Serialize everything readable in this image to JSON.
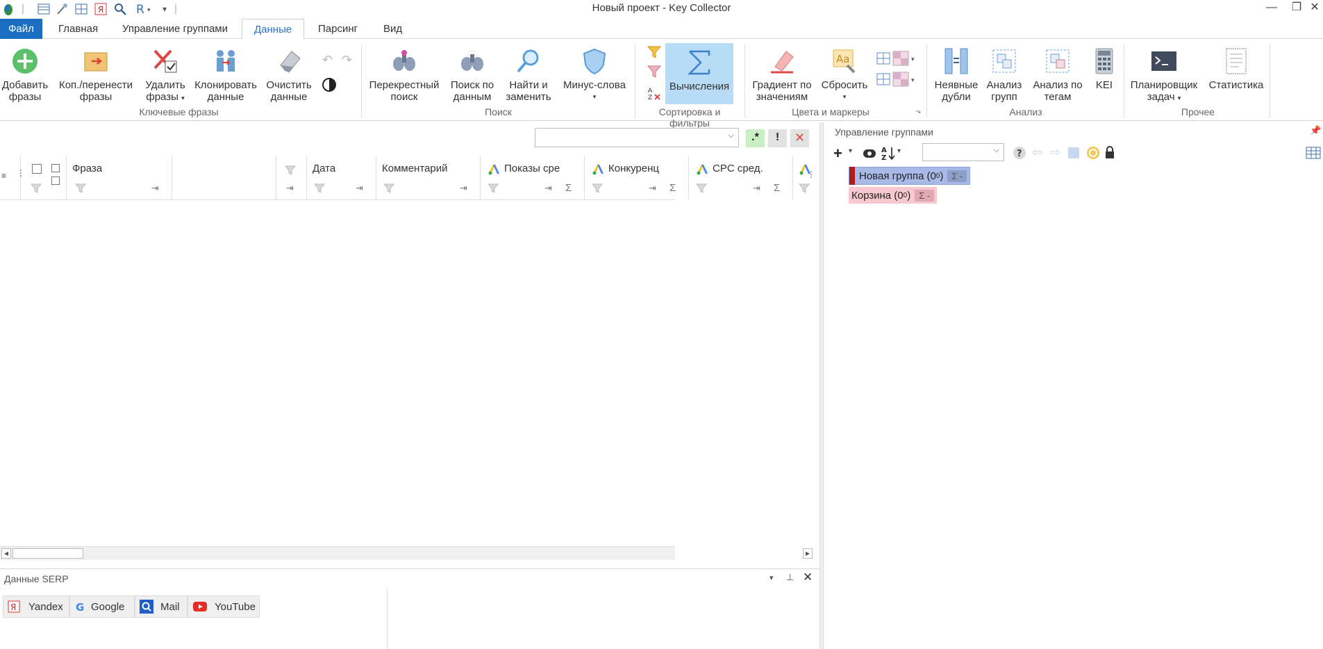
{
  "window": {
    "title": "Новый проект - Key Collector"
  },
  "tabs": [
    {
      "label": "Файл"
    },
    {
      "label": "Главная"
    },
    {
      "label": "Управление группами"
    },
    {
      "label": "Данные"
    },
    {
      "label": "Парсинг"
    },
    {
      "label": "Вид"
    }
  ],
  "ribbon": {
    "key_phrases": {
      "group_label": "Ключевые фразы",
      "add": [
        "Добавить",
        "фразы"
      ],
      "copy_move": [
        "Коп./перенести",
        "фразы"
      ],
      "delete": [
        "Удалить",
        "фразы"
      ],
      "clone": [
        "Клонировать",
        "данные"
      ],
      "clear": [
        "Очистить",
        "данные"
      ]
    },
    "search": {
      "group_label": "Поиск",
      "cross": [
        "Перекрестный",
        "поиск"
      ],
      "by_data": [
        "Поиск по",
        "данным"
      ],
      "find_replace": [
        "Найти и",
        "заменить"
      ],
      "minus_words": [
        "Минус-слова"
      ]
    },
    "sort_filters": {
      "group_label": "Сортировка и фильтры",
      "calc": "Вычисления"
    },
    "colors": {
      "group_label": "Цвета и маркеры",
      "gradient": [
        "Градиент по",
        "значениям"
      ],
      "reset": [
        "Сбросить"
      ]
    },
    "analysis": {
      "group_label": "Анализ",
      "implicit": [
        "Неявные",
        "дубли"
      ],
      "groups": [
        "Анализ",
        "групп"
      ],
      "tags": [
        "Анализ по",
        "тегам"
      ],
      "kei": "KEI"
    },
    "other": {
      "group_label": "Прочее",
      "scheduler": [
        "Планировщик",
        "задач"
      ],
      "stats": "Статистика"
    }
  },
  "filter": {
    "regex_label": ".*",
    "exclaim_label": "!",
    "value": ""
  },
  "grid": {
    "columns": [
      {
        "label": "Фраза"
      },
      {
        "label": ""
      },
      {
        "label": "Дата"
      },
      {
        "label": "Комментарий"
      },
      {
        "label": "Показы сре"
      },
      {
        "label": "Конкуренц"
      },
      {
        "label": "CPC сред."
      }
    ]
  },
  "group_panel": {
    "title": "Управление группами",
    "groups": [
      {
        "name": "Новая группа (0",
        "sup": "0",
        "close": ")",
        "badge": "Σ -",
        "color": "#a8b9e8"
      },
      {
        "name": "Корзина (0",
        "sup": "0",
        "close": ")",
        "badge": "Σ -",
        "color": "#f7c8cf"
      }
    ]
  },
  "serp": {
    "title": "Данные SERP",
    "tabs": [
      {
        "label": "Yandex",
        "icon": "yandex-icon"
      },
      {
        "label": "Google",
        "icon": "google-icon"
      },
      {
        "label": "Mail",
        "icon": "mail-search-icon"
      },
      {
        "label": "YouTube",
        "icon": "youtube-icon"
      }
    ]
  }
}
